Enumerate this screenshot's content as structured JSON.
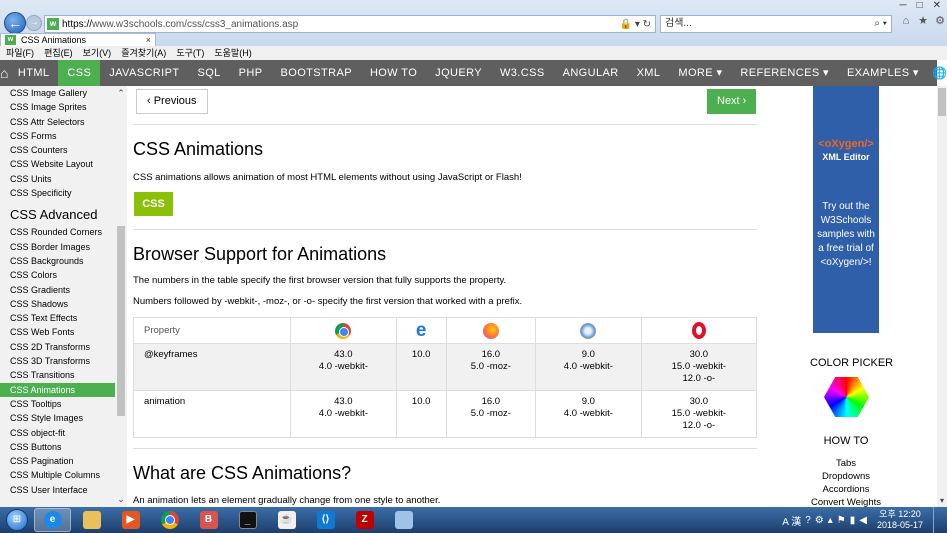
{
  "browser": {
    "url_prefix": "https://",
    "url_rest": "www.w3schools.com/css/css3_animations.asp",
    "search_placeholder": "검색...",
    "tab_title": "CSS Animations",
    "menu": [
      "파일(F)",
      "편집(E)",
      "보기(V)",
      "즐겨찾기(A)",
      "도구(T)",
      "도움말(H)"
    ]
  },
  "topnav": {
    "items": [
      "HTML",
      "CSS",
      "JAVASCRIPT",
      "SQL",
      "PHP",
      "BOOTSTRAP",
      "HOW TO",
      "JQUERY",
      "W3.CSS",
      "ANGULAR",
      "XML",
      "MORE ▾"
    ],
    "active": "CSS",
    "references": "REFERENCES ▾",
    "examples": "EXAMPLES ▾"
  },
  "sidebar": {
    "items_top": [
      "CSS Image Gallery",
      "CSS Image Sprites",
      "CSS Attr Selectors",
      "CSS Forms",
      "CSS Counters",
      "CSS Website Layout",
      "CSS Units",
      "CSS Specificity"
    ],
    "section_heading": "CSS Advanced",
    "items_adv": [
      "CSS Rounded Corners",
      "CSS Border Images",
      "CSS Backgrounds",
      "CSS Colors",
      "CSS Gradients",
      "CSS Shadows",
      "CSS Text Effects",
      "CSS Web Fonts",
      "CSS 2D Transforms",
      "CSS 3D Transforms",
      "CSS Transitions",
      "CSS Animations",
      "CSS Tooltips",
      "CSS Style Images",
      "CSS object-fit",
      "CSS Buttons",
      "CSS Pagination",
      "CSS Multiple Columns",
      "CSS User Interface"
    ],
    "active": "CSS Animations"
  },
  "main": {
    "prev": "‹ Previous",
    "next": "Next ›",
    "title": "CSS Animations",
    "intro": "CSS animations allows animation of most HTML elements without using JavaScript or Flash!",
    "badge": "CSS",
    "support_title": "Browser Support for Animations",
    "support_p1": "The numbers in the table specify the first browser version that fully supports the property.",
    "support_p2": "Numbers followed by -webkit-, -moz-, or -o- specify the first version that worked with a prefix.",
    "table": {
      "header": "Property",
      "browsers": [
        "chrome-icon",
        "edge-icon",
        "firefox-icon",
        "safari-icon",
        "opera-icon"
      ],
      "rows": [
        {
          "property": "@keyframes",
          "cells": [
            [
              "43.0",
              "4.0 -webkit-"
            ],
            [
              "10.0"
            ],
            [
              "16.0",
              "5.0 -moz-"
            ],
            [
              "9.0",
              "4.0 -webkit-"
            ],
            [
              "30.0",
              "15.0 -webkit-",
              "12.0 -o-"
            ]
          ]
        },
        {
          "property": "animation",
          "cells": [
            [
              "43.0",
              "4.0 -webkit-"
            ],
            [
              "10.0"
            ],
            [
              "16.0",
              "5.0 -moz-"
            ],
            [
              "9.0",
              "4.0 -webkit-"
            ],
            [
              "30.0",
              "15.0 -webkit-",
              "12.0 -o-"
            ]
          ]
        }
      ]
    },
    "what_title": "What are CSS Animations?",
    "what_p": "An animation lets an element gradually change from one style to another."
  },
  "right": {
    "ad_logo_pre": "<oXygen",
    "ad_logo_post": "/>",
    "ad_sub": "XML Editor",
    "ad_text": "Try out the W3Schools samples with a free trial of <oXygen/>!",
    "color_picker": "COLOR PICKER",
    "howto": "HOW TO",
    "howto_items": [
      "Tabs",
      "Dropdowns",
      "Accordions",
      "Convert Weights"
    ]
  },
  "taskbar": {
    "lang": "A 漢",
    "time": "오후 12:20",
    "date": "2018-05-17"
  }
}
